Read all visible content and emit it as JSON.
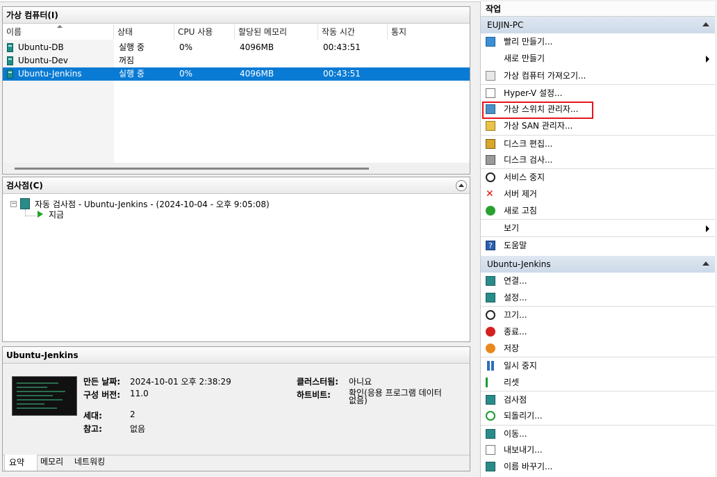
{
  "vm_panel": {
    "title": "가상 컴퓨터(I)",
    "columns": [
      "이름",
      "상태",
      "CPU 사용",
      "할당된 메모리",
      "작동 시간",
      "통지"
    ],
    "rows": [
      {
        "name": "Ubuntu-DB",
        "state": "실행 중",
        "cpu": "0%",
        "memory": "4096MB",
        "uptime": "00:43:51",
        "selected": false
      },
      {
        "name": "Ubuntu-Dev",
        "state": "꺼짐",
        "cpu": "",
        "memory": "",
        "uptime": "",
        "selected": false
      },
      {
        "name": "Ubuntu-Jenkins",
        "state": "실행 중",
        "cpu": "0%",
        "memory": "4096MB",
        "uptime": "00:43:51",
        "selected": true
      }
    ]
  },
  "checkpoint_panel": {
    "title": "검사점(C)",
    "entry": "자동 검사점 - Ubuntu-Jenkins - (2024-10-04 - 오후 9:05:08)",
    "now": "지금"
  },
  "detail_panel": {
    "title": "Ubuntu-Jenkins",
    "created_label": "만든 날짜:",
    "created_value": "2024-10-01 오후 2:38:29",
    "config_label": "구성 버전:",
    "config_value": "11.0",
    "generation_label": "세대:",
    "generation_value": "2",
    "notes_label": "참고:",
    "notes_value": "없음",
    "cluster_label": "클러스터됨:",
    "cluster_value": "아니요",
    "heartbeat_label": "하트비트:",
    "heartbeat_value_line1": "확인(응용 프로그램 데이터",
    "heartbeat_value_line2": "없음)",
    "tabs": [
      "요약",
      "메모리",
      "네트워킹"
    ]
  },
  "action_pane": {
    "title": "작업",
    "host_group": {
      "label": "EUJIN-PC",
      "items": [
        {
          "label": "빨리 만들기...",
          "icon": "quick-create-icon",
          "submenu": false,
          "sep": false
        },
        {
          "label": "새로 만들기",
          "icon": "",
          "submenu": true,
          "sep": false
        },
        {
          "label": "가상 컴퓨터 가져오기...",
          "icon": "import-icon",
          "submenu": false,
          "sep": false
        },
        {
          "label": "Hyper-V 설정...",
          "icon": "settings-doc-icon",
          "submenu": false,
          "sep": true
        },
        {
          "label": "가상 스위치 관리자...",
          "icon": "switch-icon",
          "submenu": false,
          "sep": false
        },
        {
          "label": "가상 SAN 관리자...",
          "icon": "san-icon",
          "submenu": false,
          "sep": false
        },
        {
          "label": "디스크 편집...",
          "icon": "disk-edit-icon",
          "submenu": false,
          "sep": true
        },
        {
          "label": "디스크 검사...",
          "icon": "disk-inspect-icon",
          "submenu": false,
          "sep": false
        },
        {
          "label": "서비스 중지",
          "icon": "stop-service-icon",
          "submenu": false,
          "sep": true
        },
        {
          "label": "서버 제거",
          "icon": "remove-server-icon",
          "submenu": false,
          "sep": false
        },
        {
          "label": "새로 고침",
          "icon": "refresh-icon",
          "submenu": false,
          "sep": false
        },
        {
          "label": "보기",
          "icon": "",
          "submenu": true,
          "sep": true
        },
        {
          "label": "도움말",
          "icon": "help-icon",
          "submenu": false,
          "sep": true
        }
      ]
    },
    "vm_group": {
      "label": "Ubuntu-Jenkins",
      "items": [
        {
          "label": "연결...",
          "icon": "connect-icon",
          "sep": false
        },
        {
          "label": "설정...",
          "icon": "vm-settings-icon",
          "sep": false
        },
        {
          "label": "끄기...",
          "icon": "turn-off-icon",
          "sep": true
        },
        {
          "label": "종료...",
          "icon": "shutdown-icon",
          "sep": false
        },
        {
          "label": "저장",
          "icon": "save-icon",
          "sep": false
        },
        {
          "label": "일시 중지",
          "icon": "pause-icon",
          "sep": true
        },
        {
          "label": "리셋",
          "icon": "reset-icon",
          "sep": false
        },
        {
          "label": "검사점",
          "icon": "checkpoint-icon",
          "sep": true
        },
        {
          "label": "되돌리기...",
          "icon": "revert-icon",
          "sep": false
        },
        {
          "label": "이동...",
          "icon": "move-icon",
          "sep": true
        },
        {
          "label": "내보내기...",
          "icon": "export-icon",
          "sep": false
        },
        {
          "label": "이름 바꾸기...",
          "icon": "rename-icon",
          "sep": false
        }
      ]
    }
  }
}
